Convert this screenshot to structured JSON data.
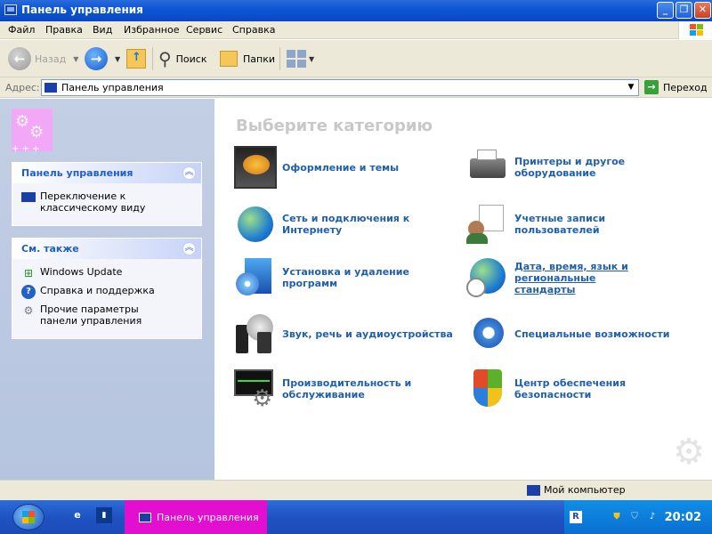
{
  "window": {
    "title": "Панель управления"
  },
  "menu": [
    "Файл",
    "Правка",
    "Вид",
    "Избранное",
    "Сервис",
    "Справка"
  ],
  "toolbar": {
    "back": "Назад",
    "search": "Поиск",
    "folders": "Папки"
  },
  "address": {
    "label": "Адрес:",
    "value": "Панель управления",
    "go": "Переход"
  },
  "sidebar": {
    "panel": {
      "title": "Панель управления",
      "items": [
        {
          "label": "Переключение к классическому виду",
          "icon": "monitor-icon"
        }
      ]
    },
    "see_also": {
      "title": "См. также",
      "items": [
        {
          "label": "Windows Update",
          "icon": "windows-update-icon"
        },
        {
          "label": "Справка и поддержка",
          "icon": "help-icon"
        },
        {
          "label": "Прочие параметры панели управления",
          "icon": "gear-icon"
        }
      ]
    }
  },
  "main": {
    "heading": "Выберите категорию",
    "categories": [
      {
        "label": "Оформление и темы",
        "icon": "themes-icon"
      },
      {
        "label": "Принтеры и другое оборудование",
        "icon": "printer-icon"
      },
      {
        "label": "Сеть и подключения к Интернету",
        "icon": "network-globe-icon"
      },
      {
        "label": "Учетные записи пользователей",
        "icon": "user-accounts-icon"
      },
      {
        "label": "Установка и удаление программ",
        "icon": "install-programs-icon"
      },
      {
        "label": "Дата, время, язык и региональные стандарты",
        "icon": "datetime-globe-icon"
      },
      {
        "label": "Звук, речь и аудиоустройства",
        "icon": "sound-icon"
      },
      {
        "label": "Специальные возможности",
        "icon": "accessibility-icon"
      },
      {
        "label": "Производительность и обслуживание",
        "icon": "performance-icon"
      },
      {
        "label": "Центр обеспечения безопасности",
        "icon": "security-shield-icon"
      }
    ]
  },
  "status": {
    "location": "Мой компьютер"
  },
  "taskbar": {
    "task": "Панель управления",
    "clock": "20:02"
  }
}
